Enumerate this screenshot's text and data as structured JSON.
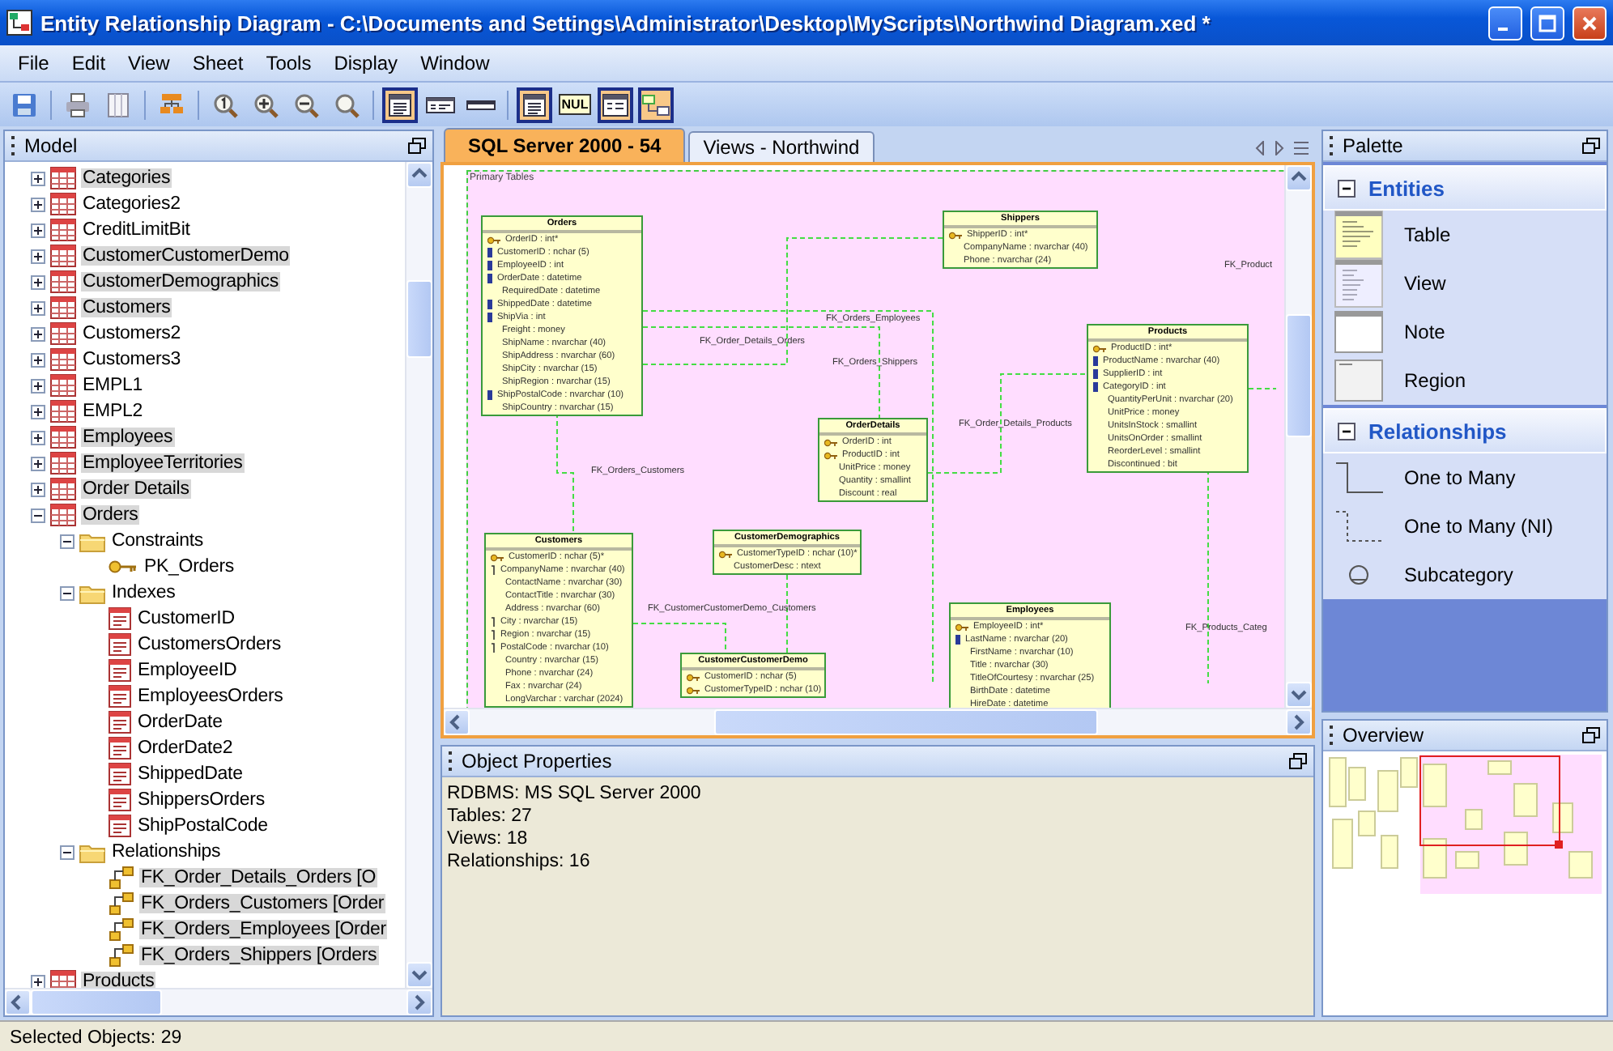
{
  "window": {
    "title": "Entity Relationship Diagram - C:\\Documents and Settings\\Administrator\\Desktop\\MyScripts\\Northwind Diagram.xed *"
  },
  "menu": [
    "File",
    "Edit",
    "View",
    "Sheet",
    "Tools",
    "Display",
    "Window"
  ],
  "toolbar": [
    [
      {
        "on": false
      }
    ],
    [
      {
        "on": false
      },
      {
        "on": false
      }
    ],
    [
      {
        "on": false
      }
    ],
    [
      {
        "on": false
      },
      {
        "on": false
      },
      {
        "on": false
      },
      {
        "on": false
      }
    ],
    [
      {
        "on": true
      },
      {
        "on": false
      },
      {
        "on": false
      }
    ],
    [
      {
        "on": true
      },
      {
        "label": "NUL",
        "on": false
      },
      {
        "on": true
      },
      {
        "on": true
      }
    ]
  ],
  "model": {
    "title": "Model",
    "tree": [
      {
        "label": "Categories",
        "kind": "table",
        "selected": true,
        "expanded": false
      },
      {
        "label": "Categories2",
        "kind": "table",
        "selected": false,
        "expanded": false
      },
      {
        "label": "CreditLimitBit",
        "kind": "table",
        "selected": false,
        "expanded": false
      },
      {
        "label": "CustomerCustomerDemo",
        "kind": "table",
        "selected": true,
        "expanded": false
      },
      {
        "label": "CustomerDemographics",
        "kind": "table",
        "selected": true,
        "expanded": false
      },
      {
        "label": "Customers",
        "kind": "table",
        "selected": true,
        "expanded": false
      },
      {
        "label": "Customers2",
        "kind": "table",
        "selected": false,
        "expanded": false
      },
      {
        "label": "Customers3",
        "kind": "table",
        "selected": false,
        "expanded": false
      },
      {
        "label": "EMPL1",
        "kind": "table",
        "selected": false,
        "expanded": false
      },
      {
        "label": "EMPL2",
        "kind": "table",
        "selected": false,
        "expanded": false
      },
      {
        "label": "Employees",
        "kind": "table",
        "selected": true,
        "expanded": false
      },
      {
        "label": "EmployeeTerritories",
        "kind": "table",
        "selected": true,
        "expanded": false
      },
      {
        "label": "Order Details",
        "kind": "table",
        "selected": true,
        "expanded": false
      },
      {
        "label": "Orders",
        "kind": "table",
        "selected": true,
        "expanded": true,
        "children": [
          {
            "label": "Constraints",
            "kind": "folder",
            "selected": false,
            "expanded": true,
            "children": [
              {
                "label": "PK_Orders",
                "kind": "key",
                "selected": false
              }
            ]
          },
          {
            "label": "Indexes",
            "kind": "folder",
            "selected": false,
            "expanded": true,
            "children": [
              {
                "label": "CustomerID",
                "kind": "index",
                "selected": false
              },
              {
                "label": "CustomersOrders",
                "kind": "index",
                "selected": false
              },
              {
                "label": "EmployeeID",
                "kind": "index",
                "selected": false
              },
              {
                "label": "EmployeesOrders",
                "kind": "index",
                "selected": false
              },
              {
                "label": "OrderDate",
                "kind": "index",
                "selected": false
              },
              {
                "label": "OrderDate2",
                "kind": "index",
                "selected": false
              },
              {
                "label": "ShippedDate",
                "kind": "index",
                "selected": false
              },
              {
                "label": "ShippersOrders",
                "kind": "index",
                "selected": false
              },
              {
                "label": "ShipPostalCode",
                "kind": "index",
                "selected": false
              }
            ]
          },
          {
            "label": "Relationships",
            "kind": "folder",
            "selected": false,
            "expanded": true,
            "children": [
              {
                "label": "FK_Order_Details_Orders [O",
                "kind": "relationship",
                "selected": true
              },
              {
                "label": "FK_Orders_Customers [Order",
                "kind": "relationship",
                "selected": true
              },
              {
                "label": "FK_Orders_Employees [Order",
                "kind": "relationship",
                "selected": true
              },
              {
                "label": "FK_Orders_Shippers [Orders",
                "kind": "relationship",
                "selected": true
              }
            ]
          }
        ]
      },
      {
        "label": "Products",
        "kind": "table",
        "selected": true,
        "expanded": false
      }
    ]
  },
  "diagram": {
    "tabs": [
      {
        "label": "SQL Server 2000 - 54",
        "selected": true
      },
      {
        "label": "Views - Northwind",
        "selected": false
      }
    ],
    "region": {
      "label": "Primary Tables"
    },
    "entities": [
      {
        "name": "Orders",
        "fields": [
          {
            "text": "OrderID : int*",
            "kind": "pk"
          },
          {
            "text": "CustomerID : nchar (5)",
            "kind": "index"
          },
          {
            "text": "EmployeeID : int",
            "kind": "index"
          },
          {
            "text": "OrderDate : datetime",
            "kind": "index"
          },
          {
            "text": "RequiredDate : datetime",
            "kind": "plain"
          },
          {
            "text": "ShippedDate : datetime",
            "kind": "index"
          },
          {
            "text": "ShipVia : int",
            "kind": "index"
          },
          {
            "text": "Freight : money",
            "kind": "plain"
          },
          {
            "text": "ShipName : nvarchar (40)",
            "kind": "plain"
          },
          {
            "text": "ShipAddress : nvarchar (60)",
            "kind": "plain"
          },
          {
            "text": "ShipCity : nvarchar (15)",
            "kind": "plain"
          },
          {
            "text": "ShipRegion : nvarchar (15)",
            "kind": "plain"
          },
          {
            "text": "ShipPostalCode : nvarchar (10)",
            "kind": "index"
          },
          {
            "text": "ShipCountry : nvarchar (15)",
            "kind": "plain"
          }
        ]
      },
      {
        "name": "Shippers",
        "fields": [
          {
            "text": "ShipperID : int*",
            "kind": "pk"
          },
          {
            "text": "CompanyName : nvarchar (40)",
            "kind": "plain"
          },
          {
            "text": "Phone : nvarchar (24)",
            "kind": "plain"
          }
        ]
      },
      {
        "name": "Products",
        "fields": [
          {
            "text": "ProductID : int*",
            "kind": "pk"
          },
          {
            "text": "ProductName : nvarchar (40)",
            "kind": "index"
          },
          {
            "text": "SupplierID : int",
            "kind": "index"
          },
          {
            "text": "CategoryID : int",
            "kind": "index"
          },
          {
            "text": "QuantityPerUnit : nvarchar (20)",
            "kind": "plain"
          },
          {
            "text": "UnitPrice : money",
            "kind": "plain"
          },
          {
            "text": "UnitsInStock : smallint",
            "kind": "plain"
          },
          {
            "text": "UnitsOnOrder : smallint",
            "kind": "plain"
          },
          {
            "text": "ReorderLevel : smallint",
            "kind": "plain"
          },
          {
            "text": "Discontinued : bit",
            "kind": "plain"
          }
        ]
      },
      {
        "name": "OrderDetails",
        "fields": [
          {
            "text": "OrderID : int",
            "kind": "pk"
          },
          {
            "text": "ProductID : int",
            "kind": "pk"
          },
          {
            "text": "UnitPrice : money",
            "kind": "plain"
          },
          {
            "text": "Quantity : smallint",
            "kind": "plain"
          },
          {
            "text": "Discount : real",
            "kind": "plain"
          }
        ]
      },
      {
        "name": "Customers",
        "fields": [
          {
            "text": "CustomerID : nchar (5)*",
            "kind": "pk"
          },
          {
            "text": "CompanyName : nvarchar (40)",
            "kind": "hook"
          },
          {
            "text": "ContactName : nvarchar (30)",
            "kind": "plain"
          },
          {
            "text": "ContactTitle : nvarchar (30)",
            "kind": "plain"
          },
          {
            "text": "Address : nvarchar (60)",
            "kind": "plain"
          },
          {
            "text": "City : nvarchar (15)",
            "kind": "hook"
          },
          {
            "text": "Region : nvarchar (15)",
            "kind": "hook"
          },
          {
            "text": "PostalCode : nvarchar (10)",
            "kind": "hook"
          },
          {
            "text": "Country : nvarchar (15)",
            "kind": "plain"
          },
          {
            "text": "Phone : nvarchar (24)",
            "kind": "plain"
          },
          {
            "text": "Fax : nvarchar (24)",
            "kind": "plain"
          },
          {
            "text": "LongVarchar : varchar (2024)",
            "kind": "plain"
          }
        ]
      },
      {
        "name": "CustomerDemographics",
        "fields": [
          {
            "text": "CustomerTypeID : nchar (10)*",
            "kind": "pk"
          },
          {
            "text": "CustomerDesc : ntext",
            "kind": "plain"
          }
        ]
      },
      {
        "name": "CustomerCustomerDemo",
        "fields": [
          {
            "text": "CustomerID : nchar (5)",
            "kind": "pk"
          },
          {
            "text": "CustomerTypeID : nchar (10)",
            "kind": "pk"
          }
        ]
      },
      {
        "name": "Employees",
        "fields": [
          {
            "text": "EmployeeID : int*",
            "kind": "pk"
          },
          {
            "text": "LastName : nvarchar (20)",
            "kind": "index"
          },
          {
            "text": "FirstName : nvarchar (10)",
            "kind": "plain"
          },
          {
            "text": "Title : nvarchar (30)",
            "kind": "plain"
          },
          {
            "text": "TitleOfCourtesy : nvarchar (25)",
            "kind": "plain"
          },
          {
            "text": "BirthDate : datetime",
            "kind": "plain"
          },
          {
            "text": "HireDate : datetime",
            "kind": "plain"
          }
        ]
      }
    ],
    "relationships": [
      {
        "label": "FK_Order_Details_Orders"
      },
      {
        "label": "FK_Orders_Employees"
      },
      {
        "label": "FK_Orders_Shippers"
      },
      {
        "label": "FK_Product"
      },
      {
        "label": "FK_Order_Details_Products"
      },
      {
        "label": "FK_Orders_Customers"
      },
      {
        "label": "FK_CustomerCustomerDemo_Customers"
      },
      {
        "label": "FK_Products_Categ"
      }
    ]
  },
  "properties": {
    "title": "Object Properties",
    "lines": [
      "RDBMS: MS SQL Server 2000",
      "Tables: 27",
      "Views: 18",
      "Relationships: 16"
    ]
  },
  "palette": {
    "title": "Palette",
    "sections": [
      {
        "title": "Entities",
        "expanded": true,
        "items": [
          {
            "label": "Table"
          },
          {
            "label": "View"
          },
          {
            "label": "Note"
          },
          {
            "label": "Region"
          }
        ]
      },
      {
        "title": "Relationships",
        "expanded": true,
        "items": [
          {
            "label": "One to Many"
          },
          {
            "label": "One to Many (NI)"
          },
          {
            "label": "Subcategory"
          }
        ]
      }
    ]
  },
  "overview": {
    "title": "Overview"
  },
  "status_bar": "Selected Objects: 29"
}
